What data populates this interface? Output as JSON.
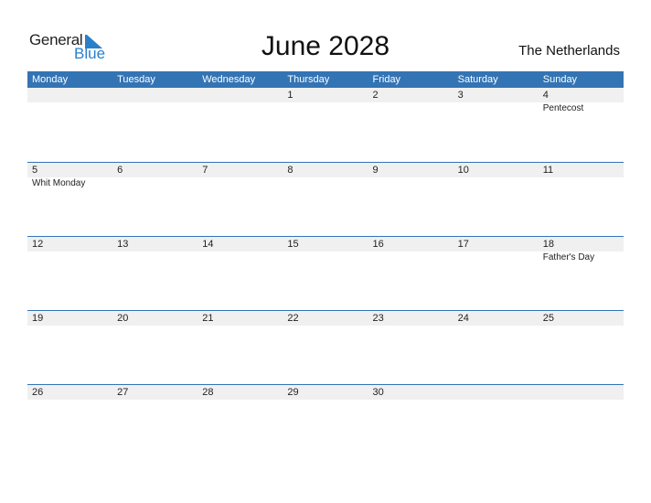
{
  "logo": {
    "general": "General",
    "blue": "Blue"
  },
  "title": "June 2028",
  "country": "The Netherlands",
  "colors": {
    "header": "#3374b5",
    "accent": "#2a7fc9",
    "daynum_bg": "#f0f0f0"
  },
  "weekdays": [
    "Monday",
    "Tuesday",
    "Wednesday",
    "Thursday",
    "Friday",
    "Saturday",
    "Sunday"
  ],
  "weeks": [
    {
      "days": [
        "",
        "",
        "",
        "1",
        "2",
        "3",
        "4"
      ],
      "events": [
        "",
        "",
        "",
        "",
        "",
        "",
        "Pentecost"
      ]
    },
    {
      "days": [
        "5",
        "6",
        "7",
        "8",
        "9",
        "10",
        "11"
      ],
      "events": [
        "Whit Monday",
        "",
        "",
        "",
        "",
        "",
        ""
      ]
    },
    {
      "days": [
        "12",
        "13",
        "14",
        "15",
        "16",
        "17",
        "18"
      ],
      "events": [
        "",
        "",
        "",
        "",
        "",
        "",
        "Father's Day"
      ]
    },
    {
      "days": [
        "19",
        "20",
        "21",
        "22",
        "23",
        "24",
        "25"
      ],
      "events": [
        "",
        "",
        "",
        "",
        "",
        "",
        ""
      ]
    },
    {
      "days": [
        "26",
        "27",
        "28",
        "29",
        "30",
        "",
        ""
      ],
      "events": [
        "",
        "",
        "",
        "",
        "",
        "",
        ""
      ]
    }
  ]
}
